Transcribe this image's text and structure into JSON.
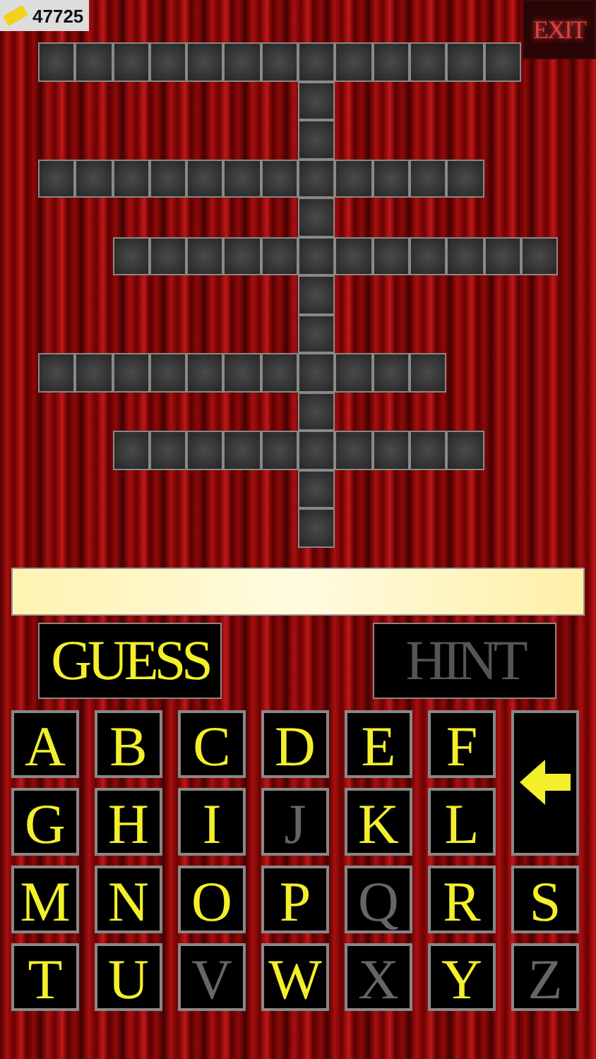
{
  "score": "47725",
  "exit": "EXIT",
  "grid": [
    [
      true,
      true,
      true,
      true,
      true,
      true,
      true,
      true,
      true,
      true,
      true,
      true,
      true,
      false
    ],
    [
      false,
      false,
      false,
      false,
      false,
      false,
      false,
      true,
      false,
      false,
      false,
      false,
      false,
      false
    ],
    [
      false,
      false,
      false,
      false,
      false,
      false,
      false,
      true,
      false,
      false,
      false,
      false,
      false,
      false
    ],
    [
      true,
      true,
      true,
      true,
      true,
      true,
      true,
      true,
      true,
      true,
      true,
      true,
      false,
      false
    ],
    [
      false,
      false,
      false,
      false,
      false,
      false,
      false,
      true,
      false,
      false,
      false,
      false,
      false,
      false
    ],
    [
      false,
      false,
      true,
      true,
      true,
      true,
      true,
      true,
      true,
      true,
      true,
      true,
      true,
      true
    ],
    [
      false,
      false,
      false,
      false,
      false,
      false,
      false,
      true,
      false,
      false,
      false,
      false,
      false,
      false
    ],
    [
      false,
      false,
      false,
      false,
      false,
      false,
      false,
      true,
      false,
      false,
      false,
      false,
      false,
      false
    ],
    [
      true,
      true,
      true,
      true,
      true,
      true,
      true,
      true,
      true,
      true,
      true,
      false,
      false,
      false
    ],
    [
      false,
      false,
      false,
      false,
      false,
      false,
      false,
      true,
      false,
      false,
      false,
      false,
      false,
      false
    ],
    [
      false,
      false,
      true,
      true,
      true,
      true,
      true,
      true,
      true,
      true,
      true,
      true,
      false,
      false
    ],
    [
      false,
      false,
      false,
      false,
      false,
      false,
      false,
      true,
      false,
      false,
      false,
      false,
      false,
      false
    ],
    [
      false,
      false,
      false,
      false,
      false,
      false,
      false,
      true,
      false,
      false,
      false,
      false,
      false,
      false
    ]
  ],
  "guess": {
    "label": "GUESS",
    "disabled": false
  },
  "hint": {
    "label": "HINT",
    "disabled": true
  },
  "keys": [
    {
      "kind": "letter",
      "label": "A",
      "disabled": false
    },
    {
      "kind": "letter",
      "label": "B",
      "disabled": false
    },
    {
      "kind": "letter",
      "label": "C",
      "disabled": false
    },
    {
      "kind": "letter",
      "label": "D",
      "disabled": false
    },
    {
      "kind": "letter",
      "label": "E",
      "disabled": false
    },
    {
      "kind": "letter",
      "label": "F",
      "disabled": false
    },
    {
      "kind": "back",
      "disabled": false
    },
    {
      "kind": "letter",
      "label": "G",
      "disabled": false
    },
    {
      "kind": "letter",
      "label": "H",
      "disabled": false
    },
    {
      "kind": "letter",
      "label": "I",
      "disabled": false
    },
    {
      "kind": "letter",
      "label": "J",
      "disabled": true
    },
    {
      "kind": "letter",
      "label": "K",
      "disabled": false
    },
    {
      "kind": "letter",
      "label": "L",
      "disabled": false
    },
    {
      "kind": "letter",
      "label": "M",
      "disabled": false
    },
    {
      "kind": "letter",
      "label": "N",
      "disabled": false
    },
    {
      "kind": "letter",
      "label": "O",
      "disabled": false
    },
    {
      "kind": "letter",
      "label": "P",
      "disabled": false
    },
    {
      "kind": "letter",
      "label": "Q",
      "disabled": true
    },
    {
      "kind": "letter",
      "label": "R",
      "disabled": false
    },
    {
      "kind": "letter",
      "label": "S",
      "disabled": false
    },
    {
      "kind": "letter",
      "label": "T",
      "disabled": false
    },
    {
      "kind": "letter",
      "label": "U",
      "disabled": false
    },
    {
      "kind": "letter",
      "label": "V",
      "disabled": true
    },
    {
      "kind": "letter",
      "label": "W",
      "disabled": false
    },
    {
      "kind": "letter",
      "label": "X",
      "disabled": true
    },
    {
      "kind": "letter",
      "label": "Y",
      "disabled": false
    },
    {
      "kind": "letter",
      "label": "Z",
      "disabled": true
    }
  ]
}
